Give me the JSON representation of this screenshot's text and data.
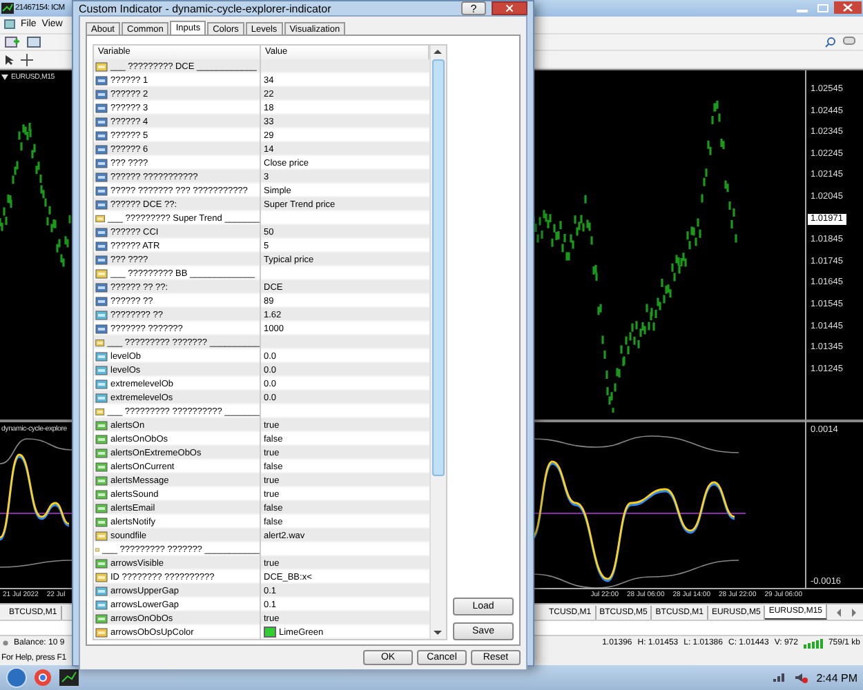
{
  "terminal": {
    "title": "21467154: ICM",
    "menu": [
      "File",
      "View"
    ]
  },
  "chart": {
    "symbol": "EURUSD,M15",
    "price_ticks": [
      "1.02545",
      "1.02445",
      "1.02345",
      "1.02245",
      "1.02145",
      "1.02045",
      "1.01845",
      "1.01745",
      "1.01645",
      "1.01545",
      "1.01445",
      "1.01345",
      "1.01245"
    ],
    "current_price": "1.01971",
    "indicator": {
      "name": "dynamic-cycle-explore",
      "ticks": [
        "0.0014",
        "-0.0016"
      ]
    },
    "time_left": [
      "21 Jul 2022",
      "22 Jul"
    ],
    "time_right": [
      "Jul 22:00",
      "28 Jul 06:00",
      "28 Jul 14:00",
      "28 Jul 22:00",
      "29 Jul 06:00"
    ]
  },
  "symbol_tabs_left": [
    {
      "label": "BTCUSD,M1",
      "selected": false
    }
  ],
  "symbol_tabs_right": [
    {
      "label": "TCUSD,M1",
      "selected": false
    },
    {
      "label": "BTCUSD,M5",
      "selected": false
    },
    {
      "label": "BTCUSD,M1",
      "selected": false
    },
    {
      "label": "EURUSD,M5",
      "selected": false
    },
    {
      "label": "EURUSD,M15",
      "selected": true
    }
  ],
  "status": {
    "balance": "Balance: 10 9",
    "quotes": [
      "1.01396",
      "H: 1.01453",
      "L: 1.01386",
      "C: 1.01443",
      "V: 972"
    ],
    "traffic": "759/1 kb",
    "help": "For Help, press F1"
  },
  "taskbar": {
    "clock": "2:44 PM"
  },
  "dialog": {
    "title": "Custom Indicator - dynamic-cycle-explorer-indicator",
    "help": "?",
    "tabs": [
      {
        "label": "About",
        "selected": false
      },
      {
        "label": "Common",
        "selected": false
      },
      {
        "label": "Inputs",
        "selected": true
      },
      {
        "label": "Colors",
        "selected": false
      },
      {
        "label": "Levels",
        "selected": false
      },
      {
        "label": "Visualization",
        "selected": false
      }
    ],
    "columns": [
      "Variable",
      "Value"
    ],
    "rows": [
      {
        "kind": "group",
        "name": "___ ????????? DCE ____________",
        "value": ""
      },
      {
        "kind": "int",
        "name": "?????? 1",
        "value": "34"
      },
      {
        "kind": "int",
        "name": "?????? 2",
        "value": "22"
      },
      {
        "kind": "int",
        "name": "?????? 3",
        "value": "18"
      },
      {
        "kind": "int",
        "name": "?????? 4",
        "value": "33"
      },
      {
        "kind": "int",
        "name": "?????? 5",
        "value": "29"
      },
      {
        "kind": "int",
        "name": "?????? 6",
        "value": "14"
      },
      {
        "kind": "int",
        "name": "??? ????",
        "value": "Close price"
      },
      {
        "kind": "int",
        "name": "?????? ???????????",
        "value": "3"
      },
      {
        "kind": "int",
        "name": "????? ??????? ??? ???????????",
        "value": "Simple"
      },
      {
        "kind": "int",
        "name": "?????? DCE ??:",
        "value": "Super Trend price"
      },
      {
        "kind": "group",
        "name": "___ ????????? Super Trend _______",
        "value": ""
      },
      {
        "kind": "int",
        "name": "?????? CCI",
        "value": "50"
      },
      {
        "kind": "int",
        "name": "?????? ATR",
        "value": "5"
      },
      {
        "kind": "int",
        "name": "??? ????",
        "value": "Typical price"
      },
      {
        "kind": "group",
        "name": "___ ????????? BB _____________",
        "value": ""
      },
      {
        "kind": "int",
        "name": "?????? ?? ??:",
        "value": "DCE"
      },
      {
        "kind": "int",
        "name": "?????? ??",
        "value": "89"
      },
      {
        "kind": "double",
        "name": "???????? ??",
        "value": "1.62"
      },
      {
        "kind": "int",
        "name": "??????? ???????",
        "value": "1000"
      },
      {
        "kind": "group",
        "name": "___ ????????? ??????? __________",
        "value": ""
      },
      {
        "kind": "double",
        "name": "levelOb",
        "value": "0.0"
      },
      {
        "kind": "double",
        "name": "levelOs",
        "value": "0.0"
      },
      {
        "kind": "double",
        "name": "extremelevelOb",
        "value": "0.0"
      },
      {
        "kind": "double",
        "name": "extremelevelOs",
        "value": "0.0"
      },
      {
        "kind": "group",
        "name": "___ ????????? ?????????? _______",
        "value": ""
      },
      {
        "kind": "bool",
        "name": "alertsOn",
        "value": "true"
      },
      {
        "kind": "bool",
        "name": "alertsOnObOs",
        "value": "false"
      },
      {
        "kind": "bool",
        "name": "alertsOnExtremeObOs",
        "value": "true"
      },
      {
        "kind": "bool",
        "name": "alertsOnCurrent",
        "value": "false"
      },
      {
        "kind": "bool",
        "name": "alertsMessage",
        "value": "true"
      },
      {
        "kind": "bool",
        "name": "alertsSound",
        "value": "true"
      },
      {
        "kind": "bool",
        "name": "alertsEmail",
        "value": "false"
      },
      {
        "kind": "bool",
        "name": "alertsNotify",
        "value": "false"
      },
      {
        "kind": "string",
        "name": "soundfile",
        "value": "alert2.wav"
      },
      {
        "kind": "group",
        "name": "___ ????????? ??????? ___________",
        "value": ""
      },
      {
        "kind": "bool",
        "name": "arrowsVisible",
        "value": "true"
      },
      {
        "kind": "string",
        "name": "ID ???????? ??????????",
        "value": "DCE_BB:x<"
      },
      {
        "kind": "double",
        "name": "arrowsUpperGap",
        "value": "0.1"
      },
      {
        "kind": "double",
        "name": "arrowsLowerGap",
        "value": "0.1"
      },
      {
        "kind": "bool",
        "name": "arrowsOnObOs",
        "value": "true"
      },
      {
        "kind": "color",
        "name": "arrowsObOsUpColor",
        "value": "LimeGreen",
        "color": "#32cd32"
      }
    ],
    "side_buttons": [
      "Load",
      "Save"
    ],
    "buttons": [
      "OK",
      "Cancel",
      "Reset"
    ]
  }
}
